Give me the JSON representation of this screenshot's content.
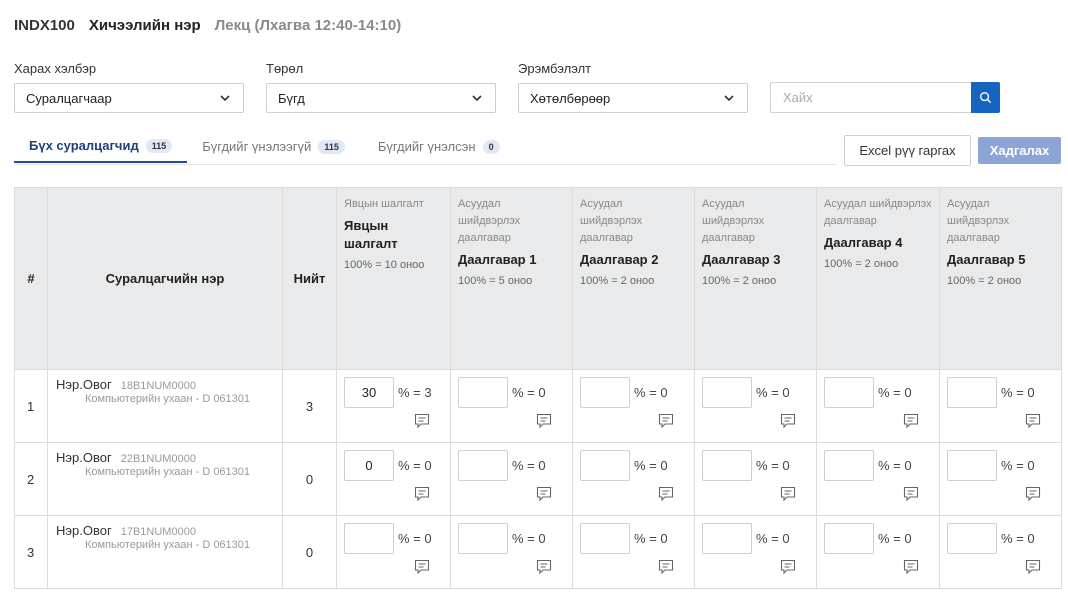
{
  "header": {
    "code": "INDX100",
    "title": "Хичээлийн нэр",
    "subtitle": "Лекц (Лхагва 12:40-14:10)"
  },
  "filters": {
    "view": {
      "label": "Харах хэлбэр",
      "value": "Суралцагчаар"
    },
    "type": {
      "label": "Төрөл",
      "value": "Бүгд"
    },
    "sort": {
      "label": "Эрэмбэлэлт",
      "value": "Хөтөлбөрөөр"
    },
    "search": {
      "placeholder": "Хайх",
      "value": ""
    }
  },
  "tabs": [
    {
      "label": "Бүх суралцагчид",
      "count": "115",
      "active": true
    },
    {
      "label": "Бүгдийг үнэлээгүй",
      "count": "115",
      "active": false
    },
    {
      "label": "Бүгдийг үнэлсэн",
      "count": "0",
      "active": false
    }
  ],
  "buttons": {
    "excel": "Excel рүү гаргах",
    "save": "Хадгалах"
  },
  "table": {
    "headers": {
      "index": "#",
      "name": "Суралцагчийн нэр",
      "total": "Нийт"
    },
    "attendance": {
      "small": "Явцын шалгалт",
      "title": "Явцын шалгалт",
      "note": "100% = 10 оноо"
    },
    "assignments": [
      {
        "small": "Асуудал шийдвэрлэх даалгавар",
        "title": "Даалгавар 1",
        "note": "100% = 5 оноо"
      },
      {
        "small": "Асуудал шийдвэрлэх даалгавар",
        "title": "Даалгавар 2",
        "note": "100% = 2 оноо"
      },
      {
        "small": "Асуудал шийдвэрлэх даалгавар",
        "title": "Даалгавар 3",
        "note": "100% = 2 оноо"
      },
      {
        "small": "Асуудал шийдвэрлэх даалгавар",
        "title": "Даалгавар 4",
        "note": "100% = 2 оноо"
      },
      {
        "small": "Асуудал шийдвэрлэх даалгавар",
        "title": "Даалгавар 5",
        "note": "100% = 2 оноо"
      }
    ],
    "rows": [
      {
        "index": "1",
        "name": "Нэр.Овог",
        "id": "18B1NUM0000",
        "dept": "Компьютерийн ухаан - D 061301",
        "total": "3",
        "scores": [
          {
            "value": "30",
            "result": "% = 3"
          },
          {
            "value": "",
            "result": "% = 0"
          },
          {
            "value": "",
            "result": "% = 0"
          },
          {
            "value": "",
            "result": "% = 0"
          },
          {
            "value": "",
            "result": "% = 0"
          },
          {
            "value": "",
            "result": "% = 0"
          }
        ]
      },
      {
        "index": "2",
        "name": "Нэр.Овог",
        "id": "22B1NUM0000",
        "dept": "Компьютерийн ухаан - D 061301",
        "total": "0",
        "scores": [
          {
            "value": "0",
            "result": "% = 0"
          },
          {
            "value": "",
            "result": "% = 0"
          },
          {
            "value": "",
            "result": "% = 0"
          },
          {
            "value": "",
            "result": "% = 0"
          },
          {
            "value": "",
            "result": "% = 0"
          },
          {
            "value": "",
            "result": "% = 0"
          }
        ]
      },
      {
        "index": "3",
        "name": "Нэр.Овог",
        "id": "17B1NUM0000",
        "dept": "Компьютерийн ухаан - D 061301",
        "total": "0",
        "scores": [
          {
            "value": "",
            "result": "% = 0"
          },
          {
            "value": "",
            "result": "% = 0"
          },
          {
            "value": "",
            "result": "% = 0"
          },
          {
            "value": "",
            "result": "% = 0"
          },
          {
            "value": "",
            "result": "% = 0"
          },
          {
            "value": "",
            "result": "% = 0"
          }
        ]
      }
    ]
  },
  "icons": {
    "chevron": "chevron-down-icon",
    "search": "search-icon",
    "comment": "comment-icon"
  },
  "colors": {
    "primary": "#1565c0",
    "save_button": "#8aa5d6",
    "header_bg": "#e8eaec",
    "active_tab": "#1f4fa0"
  }
}
